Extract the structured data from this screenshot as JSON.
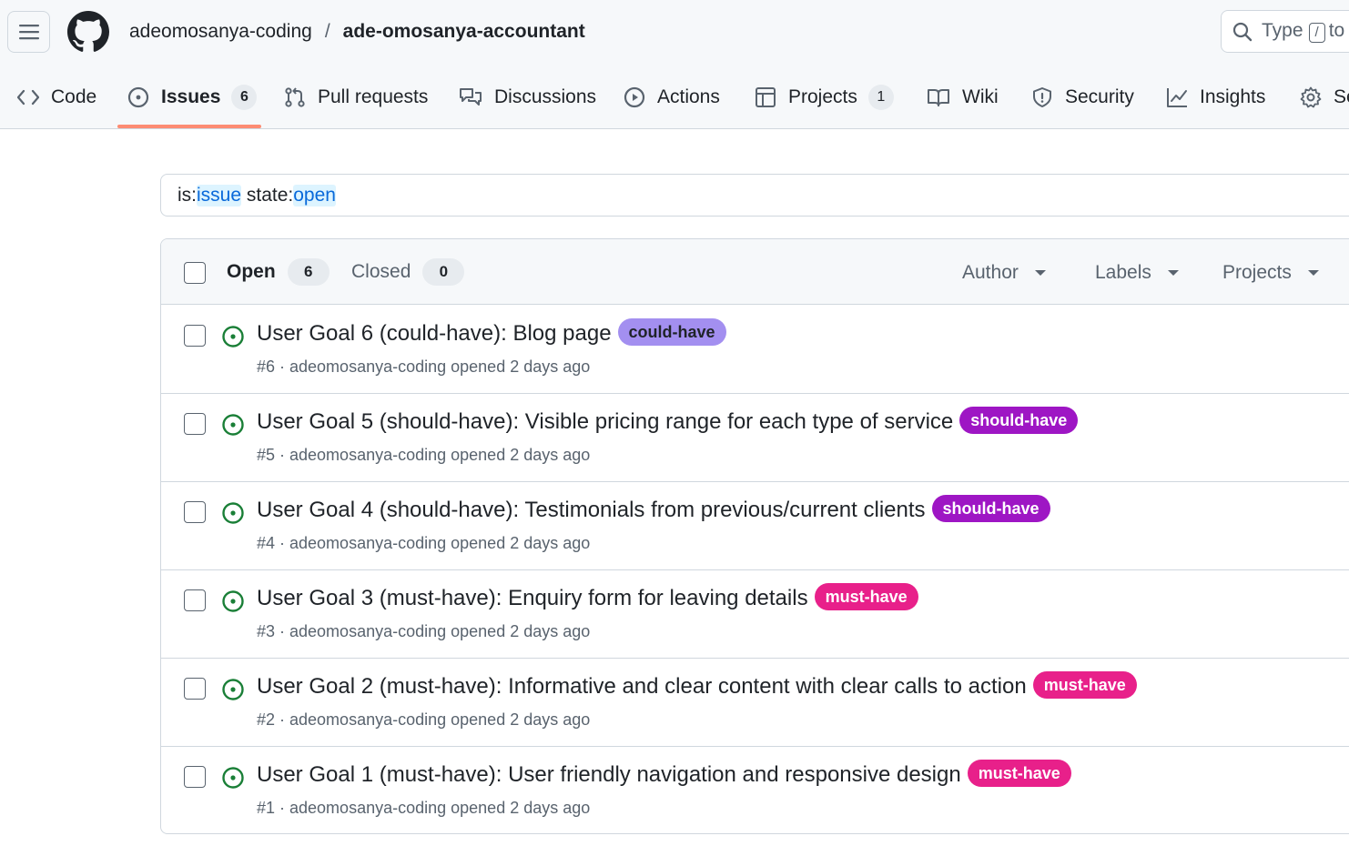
{
  "header": {
    "owner": "adeomosanya-coding",
    "separator": "/",
    "repo": "ade-omosanya-accountant",
    "search_placeholder_prefix": "Type",
    "search_key": "/",
    "search_placeholder_suffix": "to"
  },
  "tabs": [
    {
      "label": "Code",
      "icon": "code-icon"
    },
    {
      "label": "Issues",
      "icon": "issue-opened-icon",
      "count": "6",
      "active": true
    },
    {
      "label": "Pull requests",
      "icon": "git-pull-request-icon"
    },
    {
      "label": "Discussions",
      "icon": "comment-discussion-icon"
    },
    {
      "label": "Actions",
      "icon": "play-icon"
    },
    {
      "label": "Projects",
      "icon": "table-icon",
      "count": "1"
    },
    {
      "label": "Wiki",
      "icon": "book-icon"
    },
    {
      "label": "Security",
      "icon": "shield-icon"
    },
    {
      "label": "Insights",
      "icon": "graph-icon"
    },
    {
      "label": "Se",
      "icon": "gear-icon"
    }
  ],
  "filter": {
    "key1": "is:",
    "value1": "issue",
    "key2": "state:",
    "value2": "open"
  },
  "list_header": {
    "open_label": "Open",
    "open_count": "6",
    "closed_label": "Closed",
    "closed_count": "0",
    "author": "Author",
    "labels": "Labels",
    "projects": "Projects"
  },
  "colors": {
    "open_icon": "#1a7f37",
    "could_have_bg": "#a38ff0",
    "could_have_fg": "#1f2328",
    "should_have_bg": "#9e16c4",
    "must_have_bg": "#e8208a",
    "label_fg_light": "#ffffff",
    "tab_underline": "#fd8c73"
  },
  "issues": [
    {
      "title": "User Goal 6 (could-have): Blog page",
      "label": "could-have",
      "meta": "#6 · adeomosanya-coding opened 2 days ago"
    },
    {
      "title": "User Goal 5 (should-have): Visible pricing range for each type of service",
      "label": "should-have",
      "meta": "#5 · adeomosanya-coding opened 2 days ago"
    },
    {
      "title": "User Goal 4 (should-have): Testimonials from previous/current clients",
      "label": "should-have",
      "meta": "#4 · adeomosanya-coding opened 2 days ago"
    },
    {
      "title": "User Goal 3 (must-have): Enquiry form for leaving details",
      "label": "must-have",
      "meta": "#3 · adeomosanya-coding opened 2 days ago"
    },
    {
      "title": "User Goal 2 (must-have): Informative and clear content with clear calls to action",
      "label": "must-have",
      "meta": "#2 · adeomosanya-coding opened 2 days ago"
    },
    {
      "title": "User Goal 1 (must-have): User friendly navigation and responsive design",
      "label": "must-have",
      "meta": "#1 · adeomosanya-coding opened 2 days ago"
    }
  ]
}
